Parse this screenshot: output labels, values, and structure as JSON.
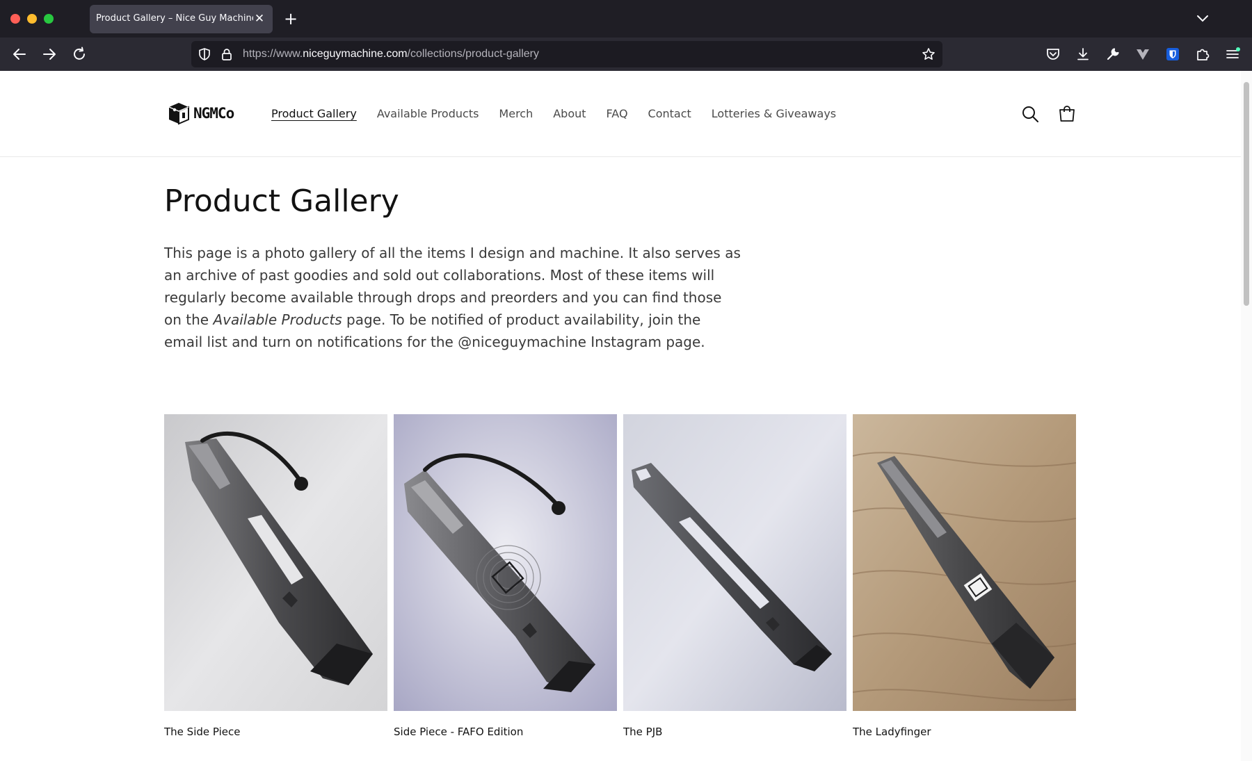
{
  "browser": {
    "tab_title": "Product Gallery – Nice Guy Machine",
    "tab_close": "✕",
    "new_tab": "+",
    "url_prefix": "https://www.",
    "url_domain": "niceguymachine.com",
    "url_path": "/collections/product-gallery"
  },
  "header": {
    "logo_text": "NGMCo",
    "nav": [
      {
        "label": "Product Gallery",
        "active": true
      },
      {
        "label": "Available Products"
      },
      {
        "label": "Merch"
      },
      {
        "label": "About"
      },
      {
        "label": "FAQ"
      },
      {
        "label": "Contact"
      },
      {
        "label": "Lotteries & Giveaways"
      }
    ]
  },
  "main": {
    "title": "Product Gallery",
    "intro_part1": "This page is a photo gallery of all the items I design and machine. It also serves as an archive of past goodies and sold out collaborations. Most of these items will regularly become available through drops and preorders and you can find those on the ",
    "intro_em": "Available Products",
    "intro_part2": " page.  To be notified of product availability, join the email list and turn on notifications for the @niceguymachine Instagram page."
  },
  "products": [
    {
      "name": "The Side Piece"
    },
    {
      "name": "Side Piece - FAFO Edition"
    },
    {
      "name": "The PJB"
    },
    {
      "name": "The Ladyfinger"
    }
  ],
  "colors": {
    "chrome_dark": "#1f1e25",
    "toolbar": "#2b2a33",
    "urlbar": "#1c1b22",
    "text": "#121212"
  }
}
